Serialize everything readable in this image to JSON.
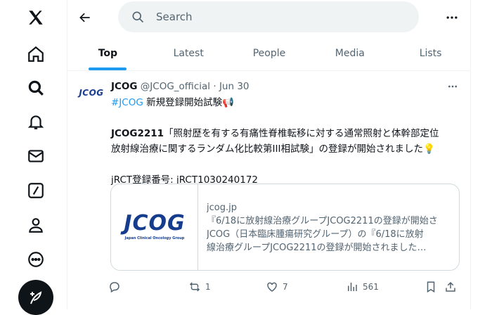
{
  "search": {
    "placeholder": "Search"
  },
  "tabs": [
    {
      "label": "Top"
    },
    {
      "label": "Latest"
    },
    {
      "label": "People"
    },
    {
      "label": "Media"
    },
    {
      "label": "Lists"
    }
  ],
  "tweet": {
    "avatar_text": "JCOG",
    "author_name": "JCOG",
    "handle": "@JCOG_official",
    "separator": " · ",
    "date": "Jun 30",
    "hashtag": "#JCOG",
    "line1_rest": " 新規登録開始試験📢",
    "line2_bold": "JCOG2211",
    "line2_rest": "「照射歴を有する有痛性脊椎転移に対する通常照射と体幹部定位",
    "line3": "放射線治療に関するランダム化比較第III相試験」の登録が開始されました💡",
    "line4": "jRCT登録番号: jRCT1030240172",
    "card": {
      "logo_text": "JCOG",
      "logo_sub": "Japan Clinical Oncology Group",
      "domain": "jcog.jp",
      "title": "『6/18に放射線治療グループJCOG2211の登録が開始さ",
      "desc1": "JCOG（日本臨床腫瘍研究グループ）の『6/18に放射",
      "desc2": "線治療グループJCOG2211の登録が開始されました…"
    },
    "actions": {
      "replies": "",
      "reposts": "1",
      "likes": "7",
      "views": "561"
    }
  },
  "colors": {
    "accent": "#1d9bf0",
    "text": "#0f1419",
    "muted": "#536471"
  }
}
